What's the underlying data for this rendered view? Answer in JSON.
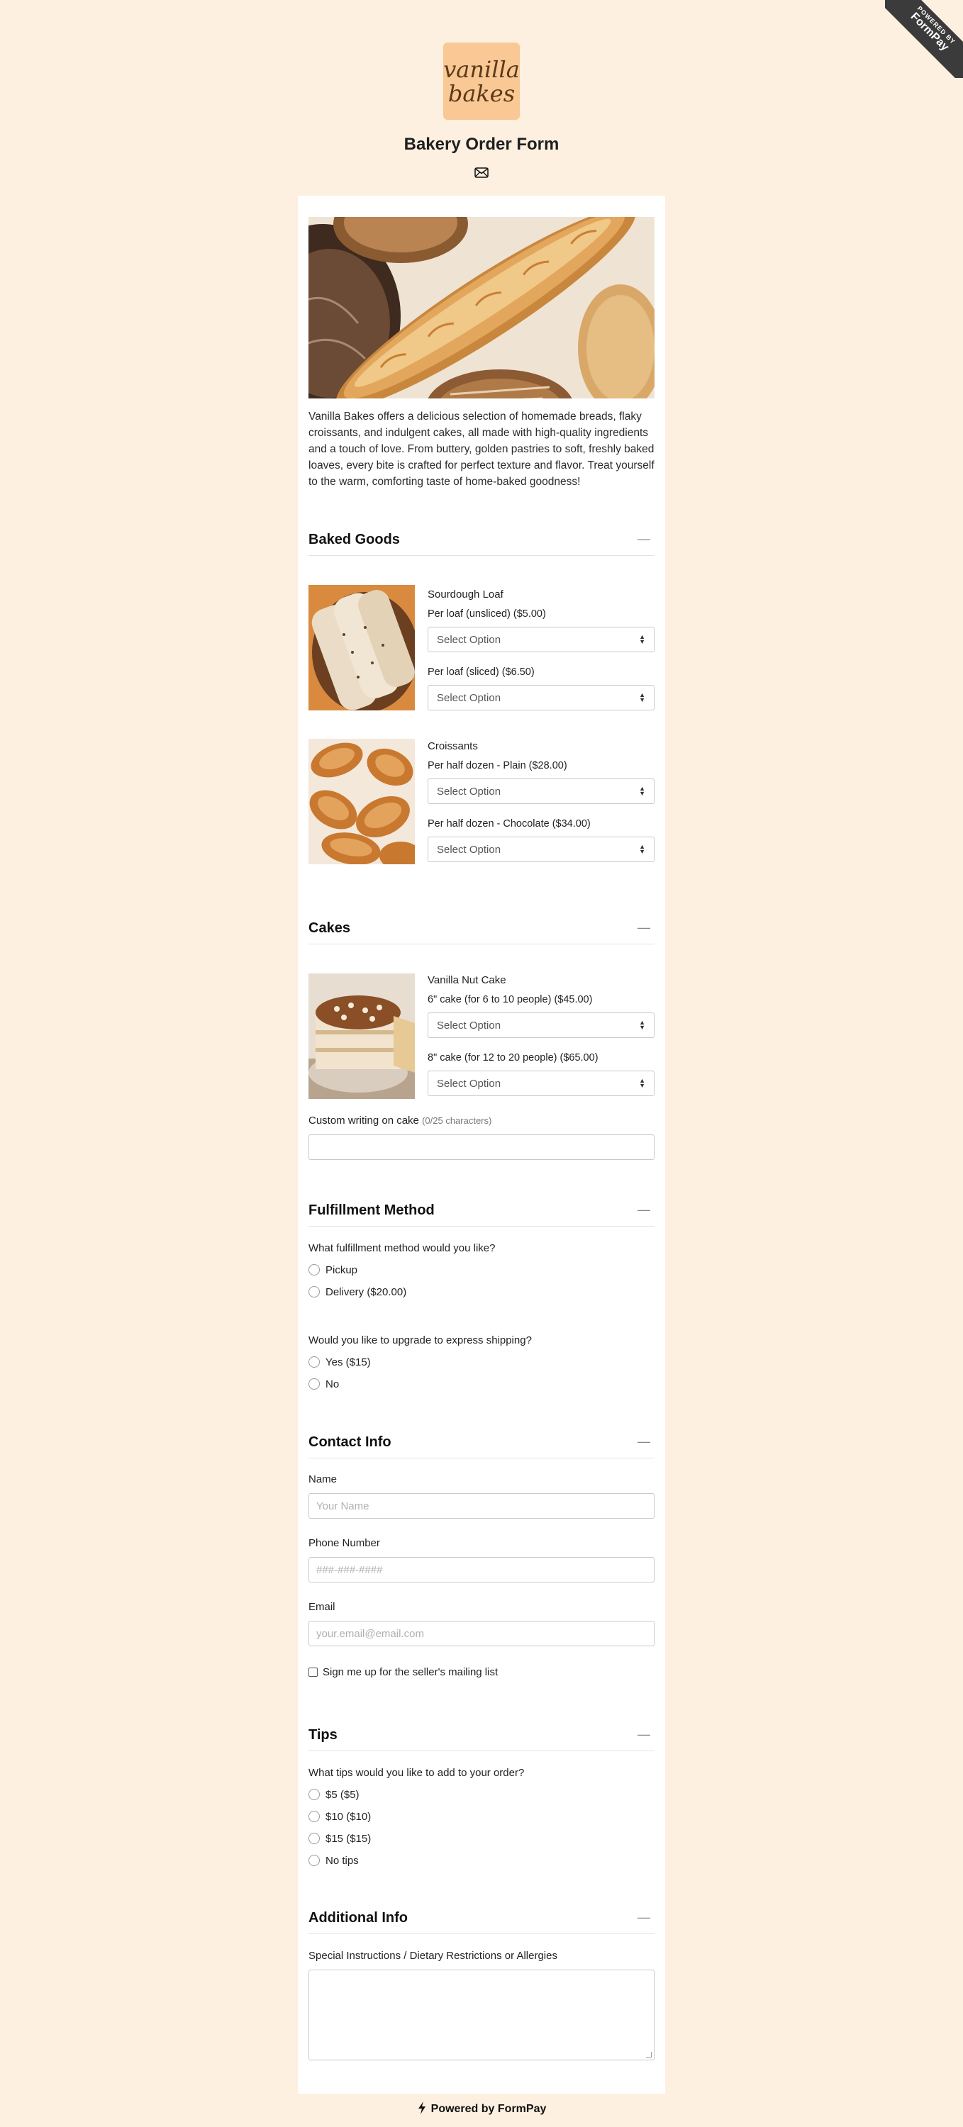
{
  "ribbon": {
    "small": "POWERED BY",
    "big": "FormPay"
  },
  "logo": {
    "line1": "vanilla",
    "line2": "bakes"
  },
  "form_title": "Bakery Order Form",
  "icons": {
    "contact": "mail-icon",
    "footer": "bolt-icon",
    "select": "chevron-updown-icon",
    "collapse": "minus-icon"
  },
  "description": "Vanilla Bakes offers a delicious selection of homemade breads, flaky croissants, and indulgent cakes, all made with high-quality ingredients and a touch of love. From buttery, golden pastries to soft, freshly baked loaves, every bite is crafted for perfect texture and flavor. Treat yourself to the warm, comforting taste of home-baked goodness!",
  "sections": {
    "baked_goods": {
      "title": "Baked Goods",
      "products": [
        {
          "name": "Sourdough Loaf",
          "options": [
            {
              "label": "Per loaf (unsliced) ($5.00)",
              "value": "Select Option"
            },
            {
              "label": "Per loaf (sliced) ($6.50)",
              "value": "Select Option"
            }
          ]
        },
        {
          "name": "Croissants",
          "options": [
            {
              "label": "Per half dozen - Plain ($28.00)",
              "value": "Select Option"
            },
            {
              "label": "Per half dozen - Chocolate ($34.00)",
              "value": "Select Option"
            }
          ]
        }
      ]
    },
    "cakes": {
      "title": "Cakes",
      "products": [
        {
          "name": "Vanilla Nut Cake",
          "options": [
            {
              "label": "6\" cake (for 6 to 10 people) ($45.00)",
              "value": "Select Option"
            },
            {
              "label": "8\" cake (for 12 to 20 people) ($65.00)",
              "value": "Select Option"
            }
          ]
        }
      ],
      "custom_writing": {
        "label": "Custom writing on cake",
        "hint": "(0/25 characters)",
        "value": ""
      }
    },
    "fulfillment": {
      "title": "Fulfillment Method",
      "question1": "What fulfillment method would you like?",
      "options1": [
        "Pickup",
        "Delivery ($20.00)"
      ],
      "question2": "Would you like to upgrade to express shipping?",
      "options2": [
        "Yes ($15)",
        "No"
      ]
    },
    "contact": {
      "title": "Contact Info",
      "name_label": "Name",
      "name_placeholder": "Your Name",
      "phone_label": "Phone Number",
      "phone_placeholder": "###-###-####",
      "email_label": "Email",
      "email_placeholder": "your.email@email.com",
      "mailing_list_label": "Sign me up for the seller's mailing list",
      "mailing_list_checked": false
    },
    "tips": {
      "title": "Tips",
      "question": "What tips would you like to add to your order?",
      "options": [
        "$5 ($5)",
        "$10 ($10)",
        "$15 ($15)",
        "No tips"
      ]
    },
    "additional": {
      "title": "Additional Info",
      "label": "Special Instructions / Dietary Restrictions or Allergies",
      "value": ""
    }
  },
  "footer": {
    "text": "Powered by FormPay"
  },
  "colors": {
    "page_bg": "#fdf0e0",
    "logo_bg": "#f9c894",
    "ribbon_bg": "#3b3b3b",
    "card_bg": "#ffffff"
  }
}
